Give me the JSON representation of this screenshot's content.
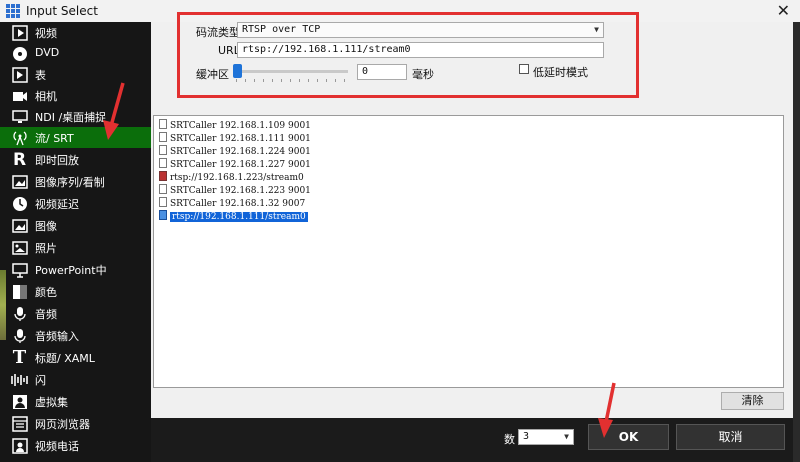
{
  "window": {
    "title": "Input Select",
    "close": "✕"
  },
  "sidebar": {
    "items": [
      {
        "label": "视频",
        "icon": "video-icon"
      },
      {
        "label": "DVD",
        "icon": "dvd-icon"
      },
      {
        "label": "表",
        "icon": "list-icon"
      },
      {
        "label": "相机",
        "icon": "camera-icon"
      },
      {
        "label": "NDI /桌面捕捉",
        "icon": "monitor-icon"
      },
      {
        "label": "流/ SRT",
        "icon": "broadcast-icon",
        "active": true
      },
      {
        "label": "即时回放",
        "icon": "replay-icon"
      },
      {
        "label": "图像序列/看制",
        "icon": "image-sequence-icon"
      },
      {
        "label": "视频延迟",
        "icon": "clock-icon"
      },
      {
        "label": "图像",
        "icon": "image-icon"
      },
      {
        "label": "照片",
        "icon": "photo-icon"
      },
      {
        "label": "PowerPoint中",
        "icon": "presentation-icon"
      },
      {
        "label": "颜色",
        "icon": "color-icon"
      },
      {
        "label": "音频",
        "icon": "microphone-icon"
      },
      {
        "label": "音频输入",
        "icon": "audio-input-icon"
      },
      {
        "label": "标题/ XAML",
        "icon": "title-icon"
      },
      {
        "label": "闪",
        "icon": "flash-icon"
      },
      {
        "label": "虚拟集",
        "icon": "virtual-set-icon"
      },
      {
        "label": "网页浏览器",
        "icon": "browser-icon"
      },
      {
        "label": "视频电话",
        "icon": "video-call-icon"
      }
    ]
  },
  "settings": {
    "stream_type_label": "码流类型",
    "stream_type_value": "RTSP over TCP",
    "url_label": "URL",
    "url_value": "rtsp://192.168.1.111/stream0",
    "buffer_label": "缓冲区",
    "buffer_value": "0",
    "buffer_unit": "毫秒",
    "buffer_slider_fraction": 0,
    "low_latency_label": "低延时模式",
    "low_latency_checked": false
  },
  "history": {
    "items": [
      {
        "text": "SRTCaller 192.168.1.109 9001",
        "type": "srt"
      },
      {
        "text": "SRTCaller 192.168.1.111 9001",
        "type": "srt"
      },
      {
        "text": "SRTCaller 192.168.1.224 9001",
        "type": "srt"
      },
      {
        "text": "SRTCaller 192.168.1.227 9001",
        "type": "srt"
      },
      {
        "text": "rtsp://192.168.1.223/stream0",
        "type": "rtsp"
      },
      {
        "text": "SRTCaller 192.168.1.223 9001",
        "type": "srt"
      },
      {
        "text": "SRTCaller 192.168.1.32 9007",
        "type": "srt"
      },
      {
        "text": "rtsp://192.168.1.111/stream0",
        "type": "rtsp",
        "selected": true
      }
    ],
    "clear_label": "清除"
  },
  "footer": {
    "count_label": "数",
    "count_value": "3",
    "ok_label": "OK",
    "cancel_label": "取消"
  },
  "colors": {
    "active_green": "#0b6e0b",
    "highlight_red": "#e23030",
    "selection_blue": "#1164d8"
  }
}
